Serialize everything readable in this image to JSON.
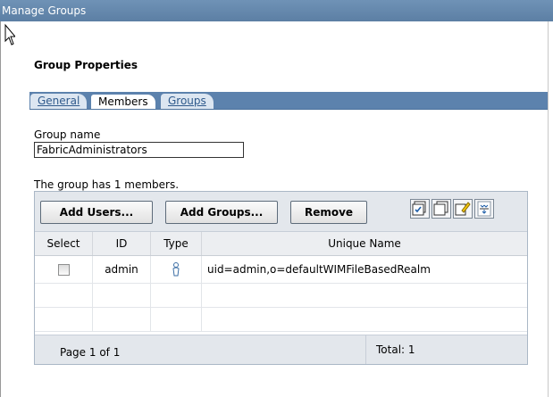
{
  "window": {
    "title": "Manage Groups"
  },
  "section": {
    "title": "Group Properties"
  },
  "tabs": [
    {
      "label": "General",
      "active": false
    },
    {
      "label": "Members",
      "active": true
    },
    {
      "label": "Groups",
      "active": false
    }
  ],
  "group_name": {
    "label": "Group name",
    "value": "FabricAdministrators"
  },
  "members_summary": "The group has 1 members.",
  "toolbar": {
    "add_users_label": "Add Users...",
    "add_groups_label": "Add Groups...",
    "remove_label": "Remove",
    "icons": [
      "select-all-icon",
      "deselect-all-icon",
      "edit-icon",
      "filter-icon"
    ]
  },
  "table": {
    "headers": {
      "select": "Select",
      "id": "ID",
      "type": "Type",
      "unique_name": "Unique Name"
    },
    "rows": [
      {
        "id": "admin",
        "type_icon": "user-icon",
        "unique_name": "uid=admin,o=defaultWIMFileBasedRealm",
        "selected": false
      }
    ]
  },
  "footer": {
    "page": "Page 1 of 1",
    "total": "Total: 1"
  },
  "colors": {
    "title_bar": "#5c7fa4",
    "tab_bar": "#5c82ad",
    "toolbar_bg": "#e3e7ec"
  }
}
